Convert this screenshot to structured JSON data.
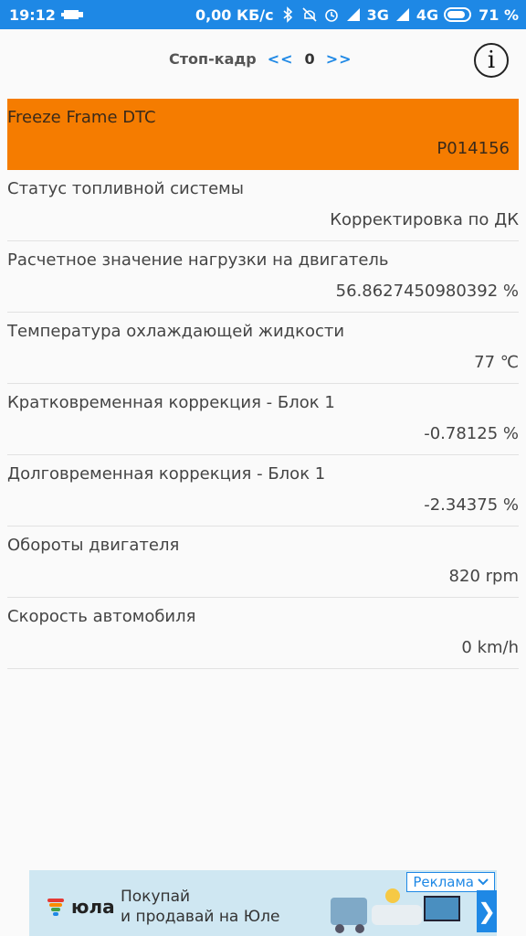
{
  "statusbar": {
    "time": "19:12",
    "network_speed": "0,00 КБ/с",
    "net1": "3G",
    "net2": "4G",
    "battery": "71 %"
  },
  "header": {
    "freeze_label": "Стоп-кадр",
    "prev_label": "<<",
    "frame_number": "0",
    "next_label": ">>",
    "info_label": "i"
  },
  "rows": [
    {
      "label": "Freeze Frame DTC",
      "value": "P014156",
      "highlight": true
    },
    {
      "label": "Статус топливной системы",
      "value": "Корректировка по ДК "
    },
    {
      "label": "Расчетное значение нагрузки на двигатель",
      "value": "56.8627450980392  %"
    },
    {
      "label": "Температура охлаждающей жидкости",
      "value": "77  ℃"
    },
    {
      "label": "Кратковременная коррекция - Блок 1",
      "value": "-0.78125  %"
    },
    {
      "label": "Долговременная коррекция - Блок 1",
      "value": "-2.34375  %"
    },
    {
      "label": "Обороты двигателя",
      "value": "820  rpm"
    },
    {
      "label": "Скорость автомобиля",
      "value": "0  km/h"
    }
  ],
  "ad": {
    "brand": "юла",
    "line1": "Покупай",
    "line2": "и продавай на Юле",
    "badge": "Реклама",
    "arrow": "❯"
  },
  "colors": {
    "statusbar": "#1e88e5",
    "highlight": "#f57c00",
    "accent": "#1e88e5"
  }
}
